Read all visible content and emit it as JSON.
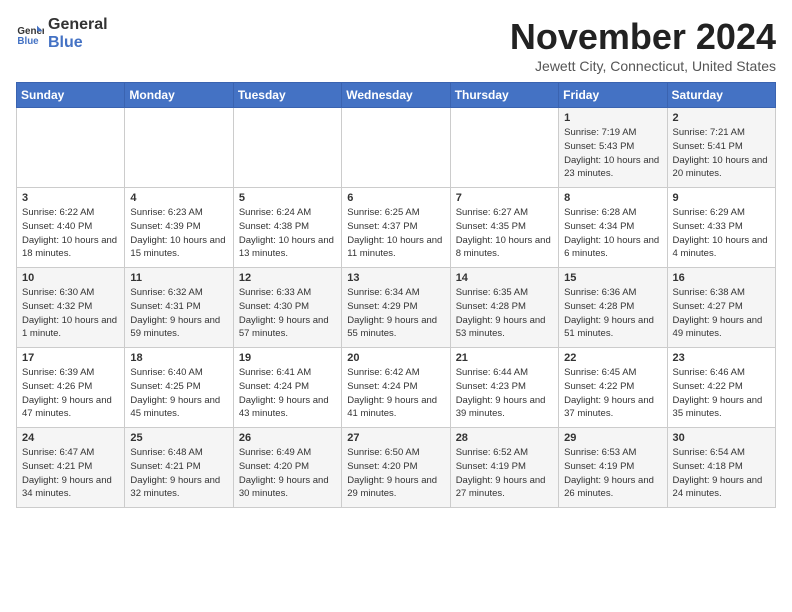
{
  "logo": {
    "line1": "General",
    "line2": "Blue"
  },
  "title": "November 2024",
  "location": "Jewett City, Connecticut, United States",
  "days_of_week": [
    "Sunday",
    "Monday",
    "Tuesday",
    "Wednesday",
    "Thursday",
    "Friday",
    "Saturday"
  ],
  "weeks": [
    [
      {
        "day": "",
        "info": ""
      },
      {
        "day": "",
        "info": ""
      },
      {
        "day": "",
        "info": ""
      },
      {
        "day": "",
        "info": ""
      },
      {
        "day": "",
        "info": ""
      },
      {
        "day": "1",
        "info": "Sunrise: 7:19 AM\nSunset: 5:43 PM\nDaylight: 10 hours and 23 minutes."
      },
      {
        "day": "2",
        "info": "Sunrise: 7:21 AM\nSunset: 5:41 PM\nDaylight: 10 hours and 20 minutes."
      }
    ],
    [
      {
        "day": "3",
        "info": "Sunrise: 6:22 AM\nSunset: 4:40 PM\nDaylight: 10 hours and 18 minutes."
      },
      {
        "day": "4",
        "info": "Sunrise: 6:23 AM\nSunset: 4:39 PM\nDaylight: 10 hours and 15 minutes."
      },
      {
        "day": "5",
        "info": "Sunrise: 6:24 AM\nSunset: 4:38 PM\nDaylight: 10 hours and 13 minutes."
      },
      {
        "day": "6",
        "info": "Sunrise: 6:25 AM\nSunset: 4:37 PM\nDaylight: 10 hours and 11 minutes."
      },
      {
        "day": "7",
        "info": "Sunrise: 6:27 AM\nSunset: 4:35 PM\nDaylight: 10 hours and 8 minutes."
      },
      {
        "day": "8",
        "info": "Sunrise: 6:28 AM\nSunset: 4:34 PM\nDaylight: 10 hours and 6 minutes."
      },
      {
        "day": "9",
        "info": "Sunrise: 6:29 AM\nSunset: 4:33 PM\nDaylight: 10 hours and 4 minutes."
      }
    ],
    [
      {
        "day": "10",
        "info": "Sunrise: 6:30 AM\nSunset: 4:32 PM\nDaylight: 10 hours and 1 minute."
      },
      {
        "day": "11",
        "info": "Sunrise: 6:32 AM\nSunset: 4:31 PM\nDaylight: 9 hours and 59 minutes."
      },
      {
        "day": "12",
        "info": "Sunrise: 6:33 AM\nSunset: 4:30 PM\nDaylight: 9 hours and 57 minutes."
      },
      {
        "day": "13",
        "info": "Sunrise: 6:34 AM\nSunset: 4:29 PM\nDaylight: 9 hours and 55 minutes."
      },
      {
        "day": "14",
        "info": "Sunrise: 6:35 AM\nSunset: 4:28 PM\nDaylight: 9 hours and 53 minutes."
      },
      {
        "day": "15",
        "info": "Sunrise: 6:36 AM\nSunset: 4:28 PM\nDaylight: 9 hours and 51 minutes."
      },
      {
        "day": "16",
        "info": "Sunrise: 6:38 AM\nSunset: 4:27 PM\nDaylight: 9 hours and 49 minutes."
      }
    ],
    [
      {
        "day": "17",
        "info": "Sunrise: 6:39 AM\nSunset: 4:26 PM\nDaylight: 9 hours and 47 minutes."
      },
      {
        "day": "18",
        "info": "Sunrise: 6:40 AM\nSunset: 4:25 PM\nDaylight: 9 hours and 45 minutes."
      },
      {
        "day": "19",
        "info": "Sunrise: 6:41 AM\nSunset: 4:24 PM\nDaylight: 9 hours and 43 minutes."
      },
      {
        "day": "20",
        "info": "Sunrise: 6:42 AM\nSunset: 4:24 PM\nDaylight: 9 hours and 41 minutes."
      },
      {
        "day": "21",
        "info": "Sunrise: 6:44 AM\nSunset: 4:23 PM\nDaylight: 9 hours and 39 minutes."
      },
      {
        "day": "22",
        "info": "Sunrise: 6:45 AM\nSunset: 4:22 PM\nDaylight: 9 hours and 37 minutes."
      },
      {
        "day": "23",
        "info": "Sunrise: 6:46 AM\nSunset: 4:22 PM\nDaylight: 9 hours and 35 minutes."
      }
    ],
    [
      {
        "day": "24",
        "info": "Sunrise: 6:47 AM\nSunset: 4:21 PM\nDaylight: 9 hours and 34 minutes."
      },
      {
        "day": "25",
        "info": "Sunrise: 6:48 AM\nSunset: 4:21 PM\nDaylight: 9 hours and 32 minutes."
      },
      {
        "day": "26",
        "info": "Sunrise: 6:49 AM\nSunset: 4:20 PM\nDaylight: 9 hours and 30 minutes."
      },
      {
        "day": "27",
        "info": "Sunrise: 6:50 AM\nSunset: 4:20 PM\nDaylight: 9 hours and 29 minutes."
      },
      {
        "day": "28",
        "info": "Sunrise: 6:52 AM\nSunset: 4:19 PM\nDaylight: 9 hours and 27 minutes."
      },
      {
        "day": "29",
        "info": "Sunrise: 6:53 AM\nSunset: 4:19 PM\nDaylight: 9 hours and 26 minutes."
      },
      {
        "day": "30",
        "info": "Sunrise: 6:54 AM\nSunset: 4:18 PM\nDaylight: 9 hours and 24 minutes."
      }
    ]
  ]
}
